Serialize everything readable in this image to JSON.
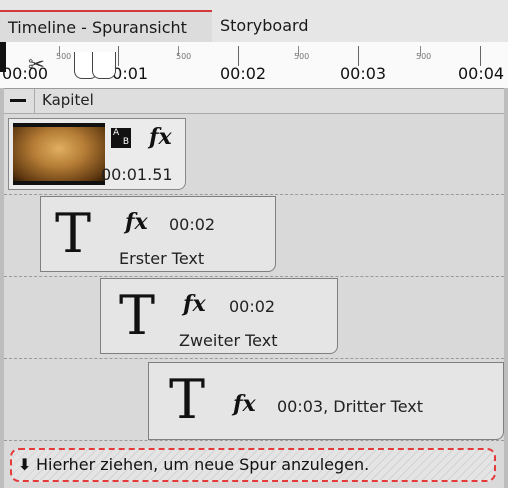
{
  "tabs": [
    {
      "label": "Timeline - Spuransicht",
      "active": true
    },
    {
      "label": "Storyboard",
      "active": false
    }
  ],
  "ruler": {
    "times": [
      "00:00",
      "00:01",
      "00:02",
      "00:03",
      "00:04"
    ],
    "minor_label": "500"
  },
  "chapter": {
    "label": "Kapitel"
  },
  "media_clip": {
    "duration": "00:01.51"
  },
  "text_clips": [
    {
      "duration": "00:02",
      "name": "Erster Text"
    },
    {
      "duration": "00:02",
      "name": "Zweiter Text"
    },
    {
      "duration_name": "00:03, Dritter Text"
    }
  ],
  "text_icon_glyph": "T",
  "fx_glyph": "fx",
  "drop_zone": {
    "arrow": "⬇",
    "label": "Hierher ziehen, um neue Spur anzulegen."
  },
  "colors": {
    "accent": "#d23a3a",
    "drop_border": "#e53a3a"
  }
}
